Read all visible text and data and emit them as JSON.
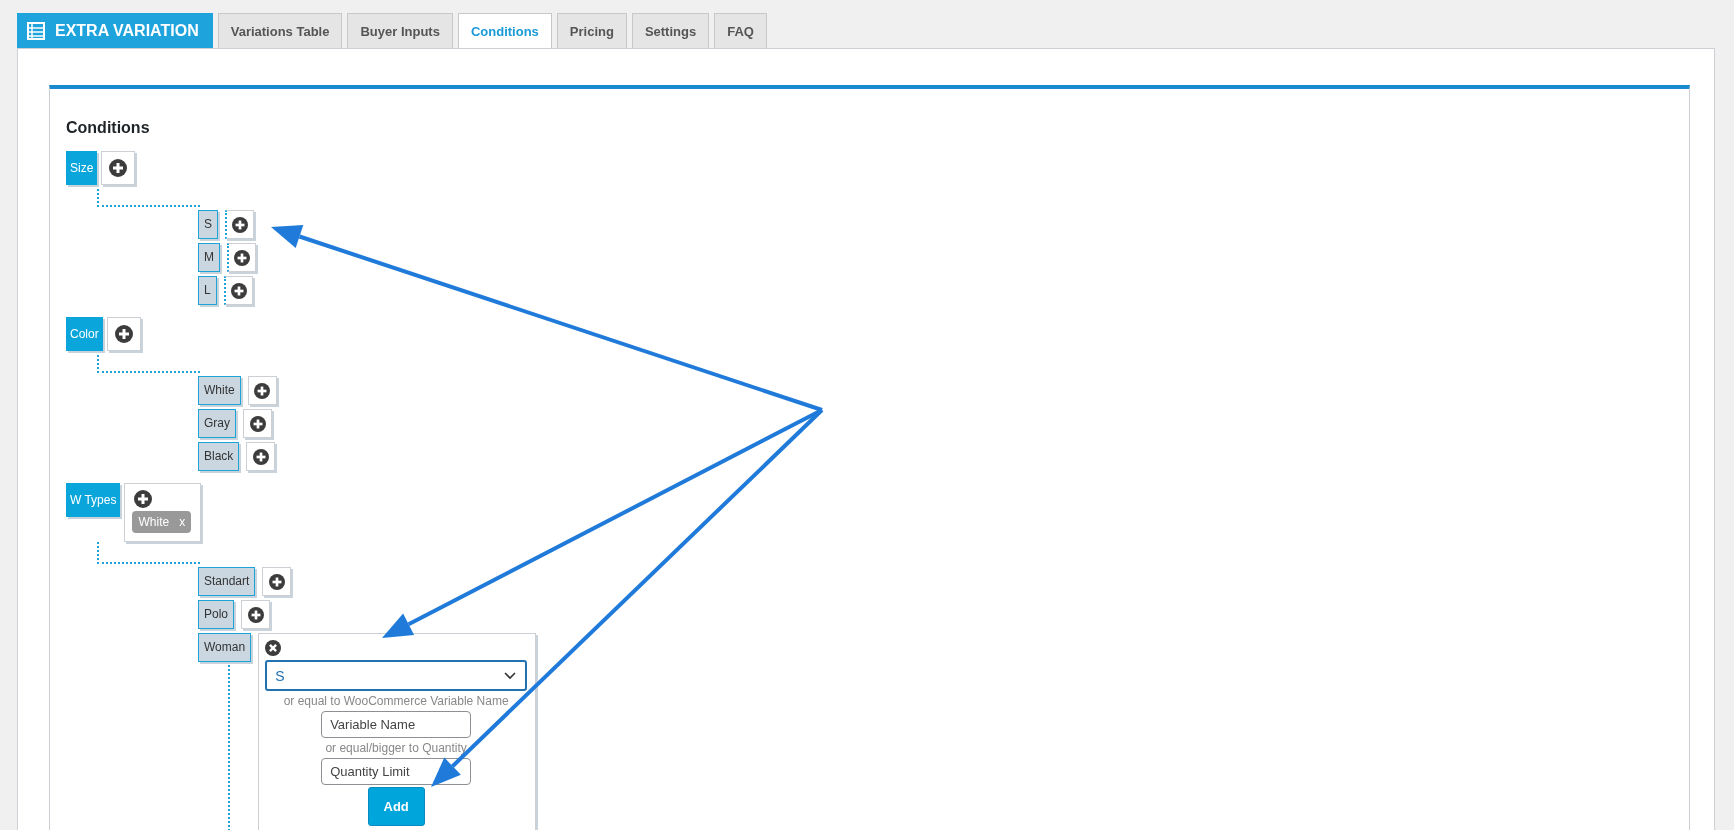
{
  "header": {
    "title": "EXTRA VARIATION"
  },
  "tabs": [
    {
      "label": "Variations Table",
      "selected": false
    },
    {
      "label": "Buyer Inputs",
      "selected": false
    },
    {
      "label": "Conditions",
      "selected": true
    },
    {
      "label": "Pricing",
      "selected": false
    },
    {
      "label": "Settings",
      "selected": false
    },
    {
      "label": "FAQ",
      "selected": false
    }
  ],
  "section_title": "Conditions",
  "groups": [
    {
      "name": "Size",
      "children": [
        {
          "name": "S"
        },
        {
          "name": "M"
        },
        {
          "name": "L"
        }
      ]
    },
    {
      "name": "Color",
      "children": [
        {
          "name": "White"
        },
        {
          "name": "Gray"
        },
        {
          "name": "Black"
        }
      ]
    },
    {
      "name": "W Types",
      "conditions": [
        {
          "label": "White",
          "remove": "x"
        }
      ],
      "children": [
        {
          "name": "Standart"
        },
        {
          "name": "Polo"
        },
        {
          "name": "Woman",
          "form": {
            "select_value": "S",
            "hint_name": "or equal to WooCommerce Variable Name",
            "name_placeholder": "Variable Name",
            "hint_quantity": "or equal/bigger to Quantity",
            "quantity_placeholder": "Quantity Limit",
            "add_label": "Add"
          }
        }
      ]
    }
  ]
}
